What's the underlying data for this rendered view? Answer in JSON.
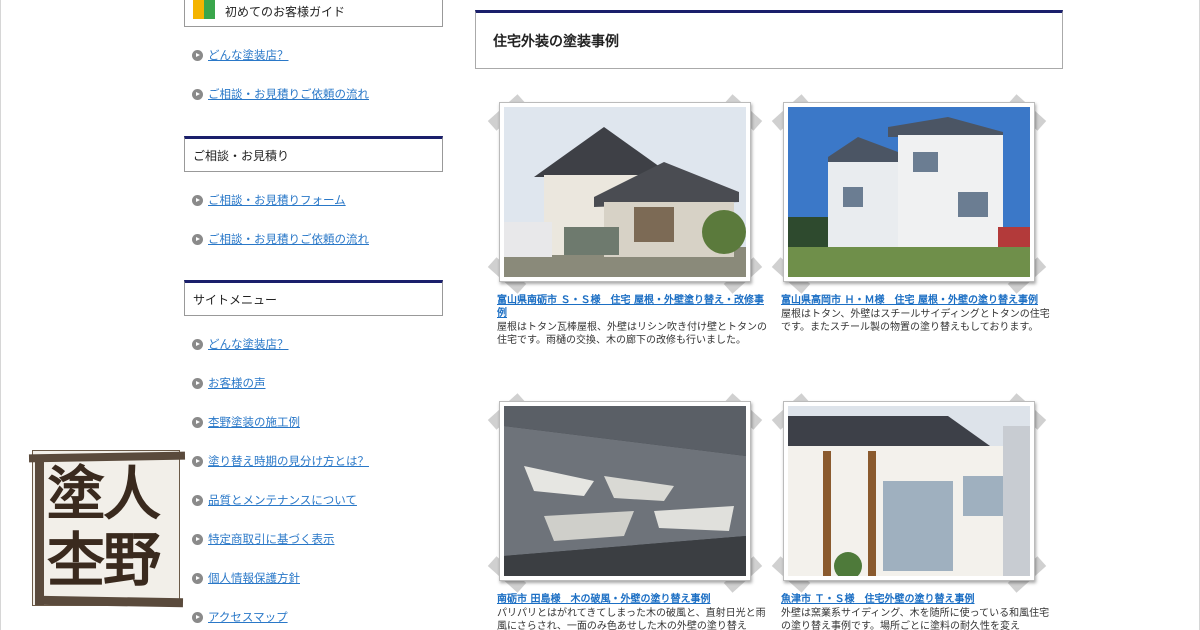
{
  "sidebar": {
    "guide_title": "初めてのお客様ガイド",
    "guide_links": [
      "どんな塗装店？",
      "ご相談・お見積りご依頼の流れ"
    ],
    "consult_title": "ご相談・お見積り",
    "consult_links": [
      "ご相談・お見積りフォーム",
      "ご相談・お見積りご依頼の流れ"
    ],
    "menu_title": "サイトメニュー",
    "menu_links": [
      "どんな塗装店？",
      "お客様の声",
      "杢野塗装の施工例",
      "塗り替え時期の見分け方とは？",
      "品質とメンテナンスについて",
      "特定商取引に基づく表示",
      "個人情報保護方針",
      "アクセスマップ"
    ]
  },
  "logo": {
    "line1": "塗人",
    "line2": "杢野"
  },
  "main": {
    "title": "住宅外装の塗装事例",
    "cards": [
      {
        "title": "富山県南砺市 Ｓ・Ｓ様　住宅 屋根・外壁塗り替え・改修事例",
        "desc": "屋根はトタン瓦棒屋根、外壁はリシン吹き付け壁とトタンの住宅です。雨樋の交換、木の廊下の改修も行いました。"
      },
      {
        "title": "富山県高岡市 Ｈ・Ｍ様　住宅 屋根・外壁の塗り替え事例",
        "desc": "屋根はトタン、外壁はスチールサイディングとトタンの住宅です。またスチール製の物置の塗り替えもしております。"
      },
      {
        "title": "南砺市 田島様　木の破風・外壁の塗り替え事例",
        "desc": "パリパリとはがれてきてしまった木の破風と、直射日光と雨風にさらされ、一面のみ色あせした木の外壁の塗り替え"
      },
      {
        "title": "魚津市 Ｔ・Ｓ様　住宅外壁の塗り替え事例",
        "desc": "外壁は窯業系サイディング、木を随所に使っている和風住宅の塗り替え事例です。場所ごとに塗料の耐久性を変え"
      }
    ]
  },
  "colors": {
    "accent": "#1a1f6b",
    "link": "#2a78c8"
  }
}
